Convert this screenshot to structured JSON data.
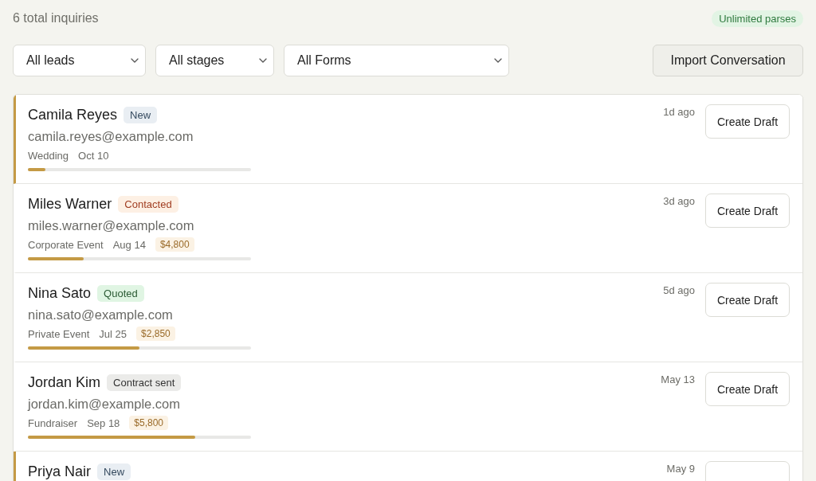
{
  "summary": {
    "count_text": "6 total inquiries",
    "plan_badge": "Unlimited parses"
  },
  "filters": [
    {
      "label": "All leads"
    },
    {
      "label": "All stages"
    },
    {
      "label": "All Forms"
    }
  ],
  "import_button": "Import Conversation",
  "rows": [
    {
      "name": "Camila Reyes",
      "stage": {
        "label": "New",
        "kind": "new"
      },
      "email": "camila.reyes@example.com",
      "event": "Wedding",
      "date": "Oct 10",
      "level": 0.08,
      "time": "1d ago",
      "action": "Create Draft",
      "unread": true
    },
    {
      "name": "Miles Warner",
      "stage": {
        "label": "Contacted",
        "kind": "contacted"
      },
      "email": "miles.warner@example.com",
      "event": "Corporate Event",
      "date": "Aug 14",
      "amount": "$4,800",
      "level": 0.25,
      "time": "3d ago",
      "action": "Create Draft",
      "unread": false
    },
    {
      "name": "Nina Sato",
      "stage": {
        "label": "Quoted",
        "kind": "quoted"
      },
      "email": "nina.sato@example.com",
      "event": "Private Event",
      "date": "Jul 25",
      "amount": "$2,850",
      "level": 0.5,
      "time": "5d ago",
      "action": "Create Draft",
      "unread": false
    },
    {
      "name": "Jordan Kim",
      "stage": {
        "label": "Contract sent",
        "kind": "contract"
      },
      "email": "jordan.kim@example.com",
      "event": "Fundraiser",
      "date": "Sep 18",
      "amount": "$5,800",
      "level": 0.75,
      "time": "May 13",
      "action": "Create Draft",
      "unread": false
    },
    {
      "name": "Priya Nair",
      "stage": {
        "label": "New",
        "kind": "new"
      },
      "time": "May 9",
      "unread": true
    }
  ]
}
